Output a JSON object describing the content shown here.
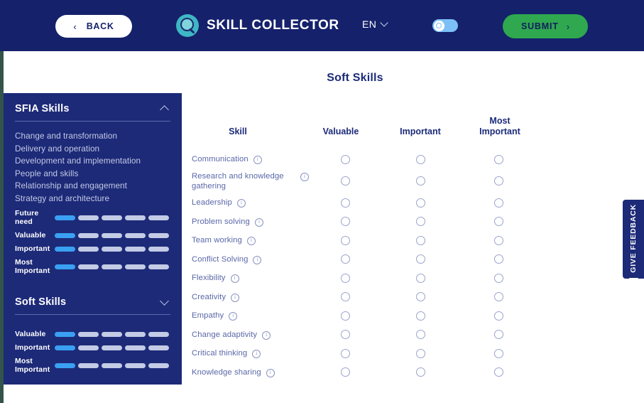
{
  "header": {
    "back_chevron": "‹",
    "back_label": "BACK",
    "brand_name": "SKILL COLLECTOR",
    "brand_logo_icon": "magnifier-logo-icon",
    "language": "EN",
    "language_chevron_icon": "chevron-down-icon",
    "theme_toggle_icon": "toggle-switch-icon",
    "submit_label": "SUBMIT",
    "submit_chevron": "›",
    "colors": {
      "header_bg": "#15216b",
      "submit_green": "#2fa84f",
      "logo_teal": "#3fb6c4",
      "toggle_track": "#7cc0f7"
    }
  },
  "main": {
    "page_title": "Soft Skills"
  },
  "sidebar": {
    "sections": [
      {
        "title": "SFIA Skills",
        "expanded": true,
        "chevron_icon": "chevron-up-icon",
        "links": [
          "Change and transformation",
          "Delivery and operation",
          "Development and implementation",
          "People and skills",
          "Relationship and engagement",
          "Strategy and architecture"
        ],
        "meters": [
          {
            "label": "Future need",
            "filled": 1,
            "total": 5
          },
          {
            "label": "Valuable",
            "filled": 1,
            "total": 5
          },
          {
            "label": "Important",
            "filled": 1,
            "total": 5
          },
          {
            "label": "Most Important",
            "filled": 1,
            "total": 5
          }
        ]
      },
      {
        "title": "Soft Skills",
        "expanded": false,
        "chevron_icon": "chevron-down-icon",
        "links": [],
        "meters": [
          {
            "label": "Valuable",
            "filled": 1,
            "total": 5
          },
          {
            "label": "Important",
            "filled": 1,
            "total": 5
          },
          {
            "label": "Most Important",
            "filled": 1,
            "total": 5
          }
        ]
      }
    ],
    "meter_colors": {
      "filled": "#3aa0f2",
      "empty": "#c3cbe6"
    }
  },
  "table": {
    "columns": [
      "Skill",
      "Valuable",
      "Important",
      "Most Important"
    ],
    "rows": [
      {
        "skill": "Communication",
        "info_icon": "info-icon",
        "valuable": false,
        "important": false,
        "most_important": false
      },
      {
        "skill": "Research and knowledge gathering",
        "info_icon": "info-icon",
        "valuable": false,
        "important": false,
        "most_important": false
      },
      {
        "skill": "Leadership",
        "info_icon": "info-icon",
        "valuable": false,
        "important": false,
        "most_important": false
      },
      {
        "skill": "Problem solving",
        "info_icon": "info-icon",
        "valuable": false,
        "important": false,
        "most_important": false
      },
      {
        "skill": "Team working",
        "info_icon": "info-icon",
        "valuable": false,
        "important": false,
        "most_important": false
      },
      {
        "skill": "Conflict Solving",
        "info_icon": "info-icon",
        "valuable": false,
        "important": false,
        "most_important": false
      },
      {
        "skill": "Flexibility",
        "info_icon": "info-icon",
        "valuable": false,
        "important": false,
        "most_important": false
      },
      {
        "skill": "Creativity",
        "info_icon": "info-icon",
        "valuable": false,
        "important": false,
        "most_important": false
      },
      {
        "skill": "Empathy",
        "info_icon": "info-icon",
        "valuable": false,
        "important": false,
        "most_important": false
      },
      {
        "skill": "Change adaptivity",
        "info_icon": "info-icon",
        "valuable": false,
        "important": false,
        "most_important": false
      },
      {
        "skill": "Critical thinking",
        "info_icon": "info-icon",
        "valuable": false,
        "important": false,
        "most_important": false
      },
      {
        "skill": "Knowledge sharing",
        "info_icon": "info-icon",
        "valuable": false,
        "important": false,
        "most_important": false
      }
    ]
  },
  "feedback": {
    "label": "GIVE FEEDBACK",
    "icon": "feedback-bubble-icon"
  }
}
